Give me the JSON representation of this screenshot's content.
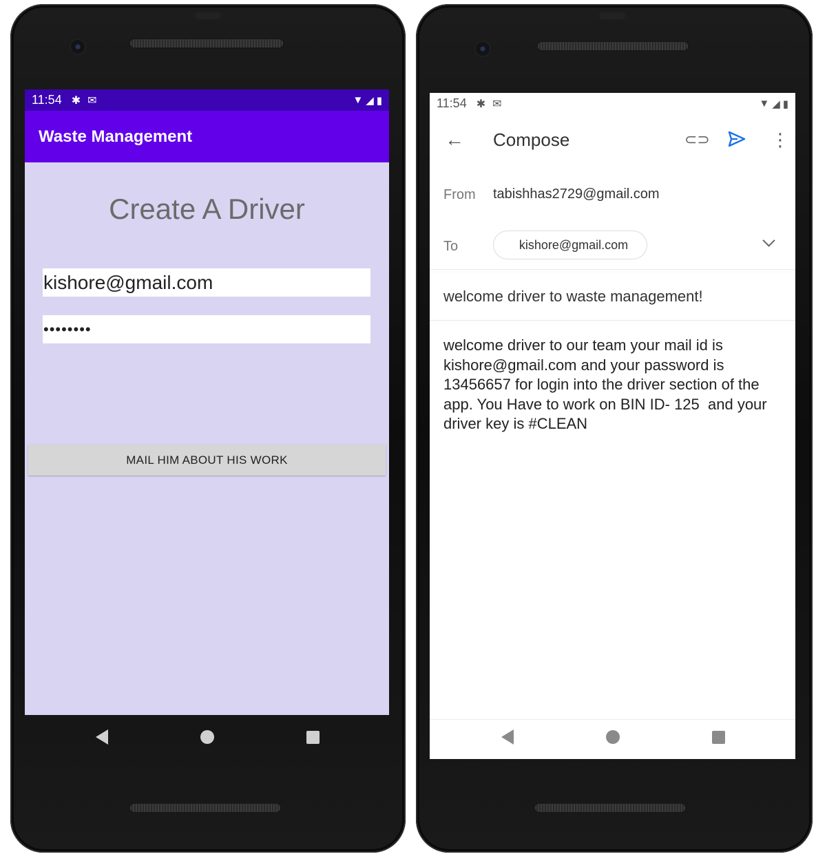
{
  "left_phone": {
    "status_bar": {
      "time": "11:54",
      "icons": [
        "gear-icon",
        "gmail-icon",
        "wifi-icon",
        "signal-icon",
        "battery-icon"
      ]
    },
    "app_bar": {
      "title": "Waste Management",
      "color": "#6200ea"
    },
    "screen": {
      "title": "Create A Driver",
      "email_value": "kishore@gmail.com",
      "password_value": "••••••••",
      "button_label": "MAIL HIM ABOUT HIS WORK",
      "background_color": "#d9d4f2"
    },
    "nav_bar": {
      "icons": [
        "back-icon",
        "home-icon",
        "recents-icon"
      ]
    }
  },
  "right_phone": {
    "status_bar": {
      "time": "11:54",
      "icons": [
        "gear-icon",
        "gmail-icon",
        "wifi-icon",
        "signal-icon",
        "battery-icon"
      ]
    },
    "compose": {
      "title": "Compose",
      "from_label": "From",
      "from_value": "tabishhas2729@gmail.com",
      "to_label": "To",
      "to_value": "kishore@gmail.com",
      "subject": "welcome driver to waste management!",
      "body": "welcome driver to our team your mail id is\nkishore@gmail.com and your password is\n13456657 for login into the driver section of the\napp. You Have to work on BIN ID- 125  and your\ndriver key is #CLEAN",
      "send_color": "#1a73e8"
    },
    "nav_bar": {
      "icons": [
        "back-icon",
        "home-icon",
        "recents-icon"
      ]
    }
  }
}
